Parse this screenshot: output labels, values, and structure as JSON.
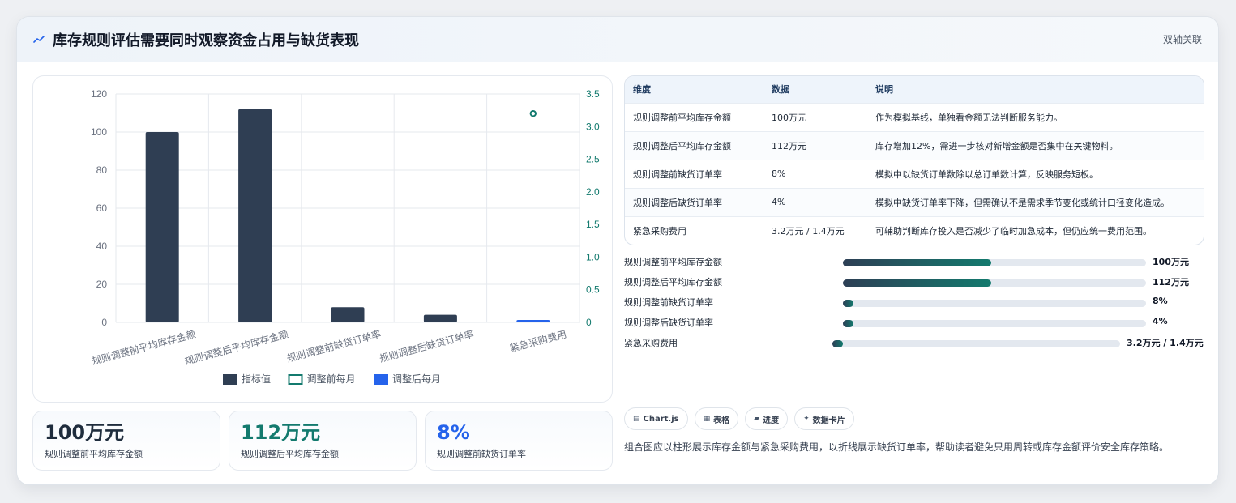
{
  "header": {
    "title": "库存规则评估需要同时观察资金占用与缺货表现",
    "tag": "双轴关联"
  },
  "chart_data": {
    "type": "bar",
    "categories": [
      "规则调整前平均库存金额",
      "规则调整后平均库存金额",
      "规则调整前缺货订单率",
      "规则调整后缺货订单率",
      "紧急采购费用"
    ],
    "series": [
      {
        "name": "指标值",
        "type": "bar",
        "axis": "left",
        "color": "#2f3e53",
        "values": [
          100,
          112,
          8,
          4,
          null
        ]
      },
      {
        "name": "调整前每月",
        "type": "point",
        "axis": "right",
        "color": "#137a6e",
        "values": [
          null,
          null,
          null,
          null,
          3.2
        ]
      },
      {
        "name": "调整后每月",
        "type": "bar",
        "axis": "right",
        "color": "#2563eb",
        "values": [
          null,
          null,
          null,
          null,
          0.02
        ]
      }
    ],
    "y_left": {
      "min": 0,
      "max": 120,
      "ticks": [
        "0",
        "20",
        "40",
        "60",
        "80",
        "100",
        "120"
      ]
    },
    "y_right": {
      "min": 0,
      "max": 3.5,
      "ticks": [
        "0",
        "0.5",
        "1.0",
        "1.5",
        "2.0",
        "2.5",
        "3.0",
        "3.5"
      ]
    },
    "grid": true,
    "legend": "bottom"
  },
  "stats": [
    {
      "value": "100万元",
      "label": "规则调整前平均库存金额",
      "color": "#1f2d3d"
    },
    {
      "value": "112万元",
      "label": "规则调整后平均库存金额",
      "color": "#137a6e"
    },
    {
      "value": "8%",
      "label": "规则调整前缺货订单率",
      "color": "#2563eb"
    }
  ],
  "table": {
    "headers": [
      "维度",
      "数据",
      "说明"
    ],
    "rows": [
      [
        "规则调整前平均库存金额",
        "100万元",
        "作为模拟基线，单独看金额无法判断服务能力。"
      ],
      [
        "规则调整后平均库存金额",
        "112万元",
        "库存增加12%，需进一步核对新增金额是否集中在关键物料。"
      ],
      [
        "规则调整前缺货订单率",
        "8%",
        "模拟中以缺货订单数除以总订单数计算，反映服务短板。"
      ],
      [
        "规则调整后缺货订单率",
        "4%",
        "模拟中缺货订单率下降，但需确认不是需求季节变化或统计口径变化造成。"
      ],
      [
        "紧急采购费用",
        "3.2万元 / 1.4万元",
        "可辅助判断库存投入是否减少了临时加急成本，但仍应统一费用范围。"
      ]
    ]
  },
  "progress": [
    {
      "label": "规则调整前平均库存金额",
      "value": "100万元",
      "fraction": 0.49
    },
    {
      "label": "规则调整后平均库存金额",
      "value": "112万元",
      "fraction": 0.49
    },
    {
      "label": "规则调整前缺货订单率",
      "value": "8%",
      "fraction": 0.035
    },
    {
      "label": "规则调整后缺货订单率",
      "value": "4%",
      "fraction": 0.035
    },
    {
      "label": "紧急采购费用",
      "value": "3.2万元 / 1.4万元",
      "fraction": 0.035
    }
  ],
  "chips": [
    {
      "icon": "chart-icon",
      "glyph": "▤",
      "label": "Chart.js"
    },
    {
      "icon": "table-icon",
      "glyph": "▦",
      "label": "表格"
    },
    {
      "icon": "progress-icon",
      "glyph": "▰",
      "label": "进度"
    },
    {
      "icon": "sparkle-icon",
      "glyph": "✦",
      "label": "数据卡片"
    }
  ],
  "description": "组合图应以柱形展示库存金额与紧急采购费用，以折线展示缺货订单率，帮助读者避免只用周转或库存金额评价安全库存策略。"
}
